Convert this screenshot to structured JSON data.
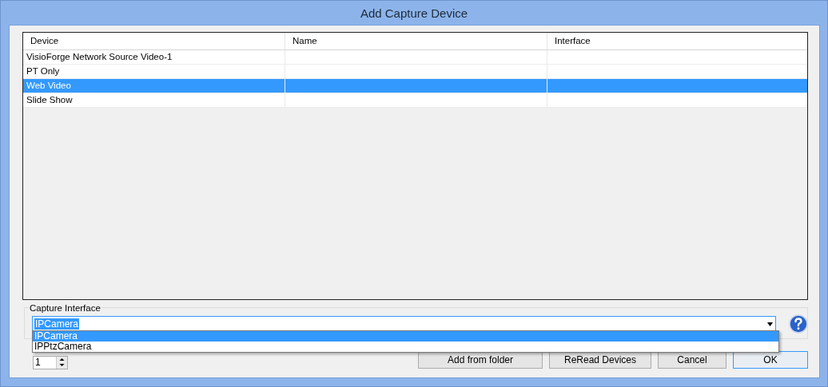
{
  "window": {
    "title": "Add Capture Device"
  },
  "table": {
    "columns": [
      "Device",
      "Name",
      "Interface"
    ],
    "rows": [
      {
        "device": "VisioForge Network Source Video-1",
        "selected": false
      },
      {
        "device": "PT Only",
        "selected": false
      },
      {
        "device": "Web Video",
        "selected": true
      },
      {
        "device": "Slide Show",
        "selected": false
      }
    ]
  },
  "capture_interface": {
    "label": "Capture Interface",
    "value": "IPCamera",
    "expanded": true,
    "options": [
      {
        "label": "IPCamera",
        "selected": true
      },
      {
        "label": "IPPtzCamera",
        "selected": false
      }
    ]
  },
  "count_spinner": {
    "value": "1"
  },
  "buttons": [
    {
      "label": "Add from folder",
      "focused": false
    },
    {
      "label": "ReRead Devices",
      "focused": false
    },
    {
      "label": "Cancel",
      "focused": false
    },
    {
      "label": "OK",
      "focused": true
    }
  ]
}
